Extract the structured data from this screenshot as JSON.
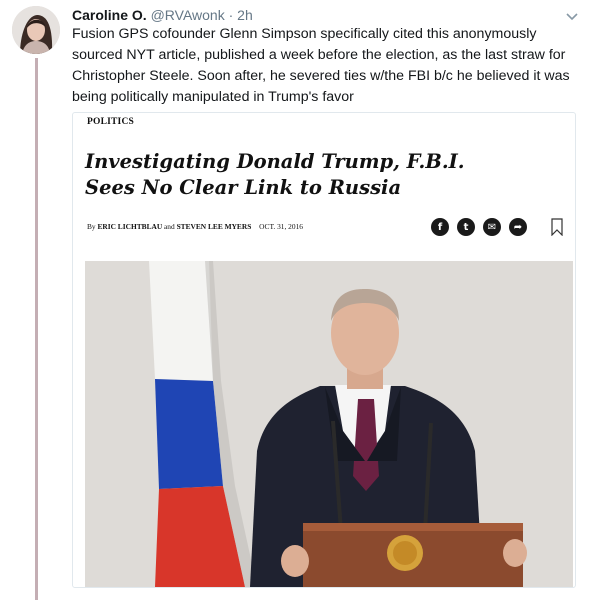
{
  "tweet": {
    "display_name": "Caroline O.",
    "handle": "@RVAwonk",
    "separator": "·",
    "time": "2h",
    "text": "Fusion GPS cofounder Glenn Simpson specifically cited this anonymously sourced NYT article, published a week before the election, as the last straw for Christopher Steele. Soon after, he severed ties w/the FBI b/c he believed it was being politically manipulated in Trump's favor"
  },
  "article": {
    "section": "POLITICS",
    "headline_line1": "Investigating Donald Trump, F.B.I.",
    "headline_line2": "Sees No Clear Link to Russia",
    "byline_prefix": "By",
    "author1": "ERIC LICHTBLAU",
    "conjunction": "and",
    "author2": "STEVEN LEE MYERS",
    "date": "OCT. 31, 2016",
    "share_icons": [
      "facebook-icon",
      "twitter-icon",
      "email-icon",
      "share-icon"
    ],
    "share_glyphs": [
      "f",
      "t",
      "✉",
      "➦"
    ],
    "bookmark_icon": "bookmark-icon"
  },
  "colors": {
    "thread_line": "#c4aeb4",
    "muted_text": "#657786",
    "card_border": "#e1e8ed",
    "flag_white": "#f4f4f2",
    "flag_blue": "#1f45b4",
    "flag_red": "#d8362a",
    "podium": "#8b4a2e"
  }
}
